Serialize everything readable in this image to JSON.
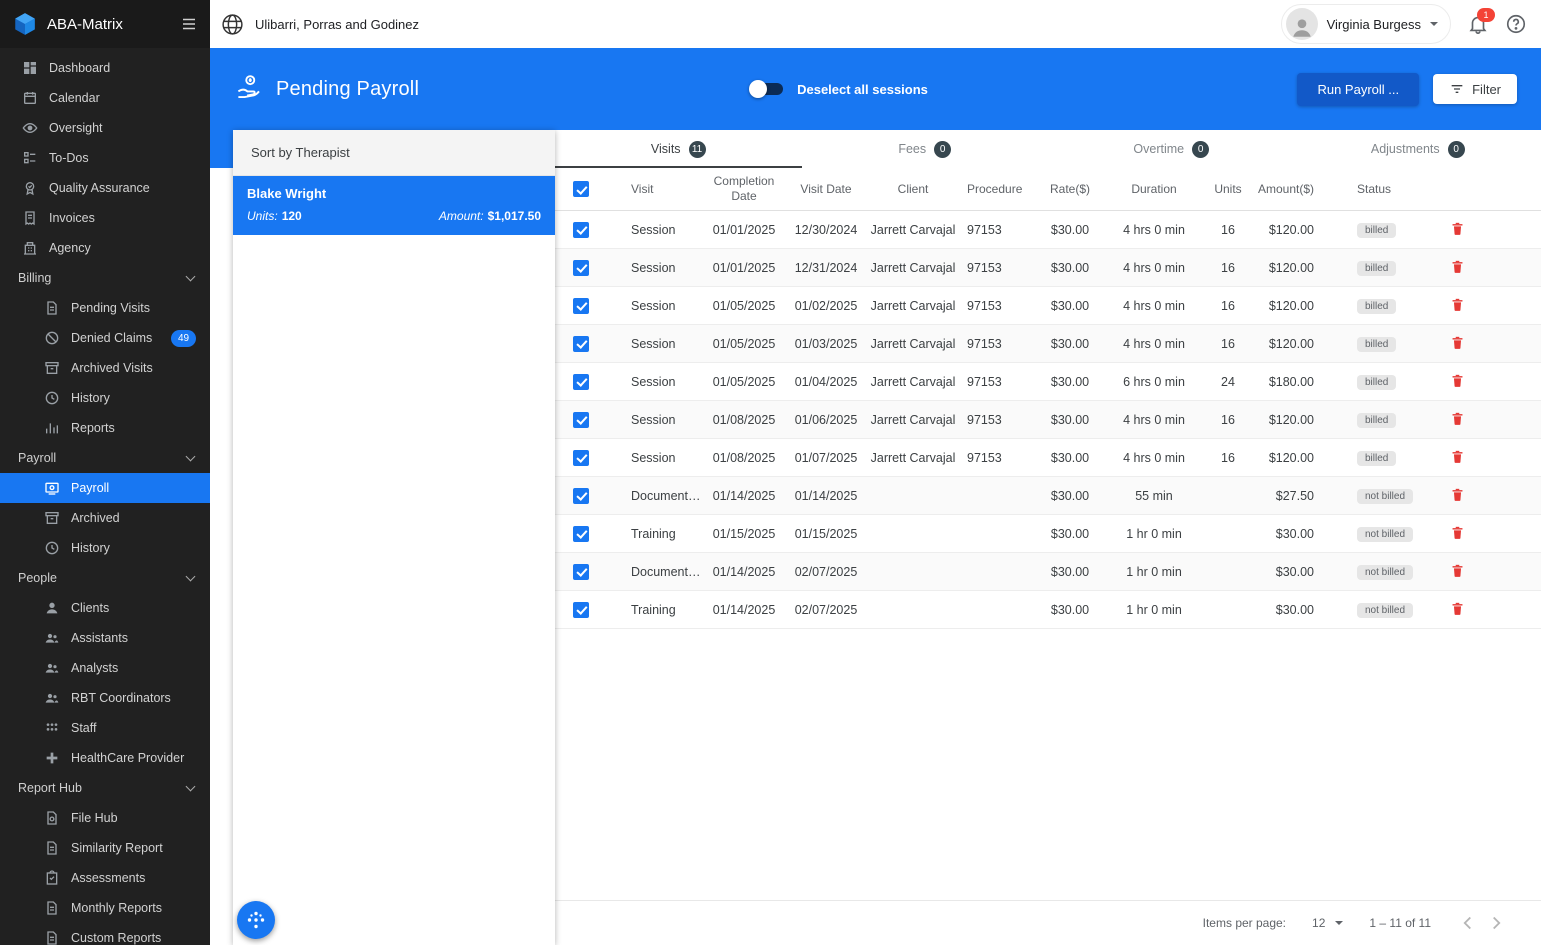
{
  "app": {
    "name": "ABA-Matrix"
  },
  "topbar": {
    "company": "Ulibarri, Porras and Godinez",
    "user": "Virginia Burgess",
    "notification_count": "1"
  },
  "page_header": {
    "title": "Pending Payroll",
    "toggle_label": "Deselect all sessions",
    "run_button": "Run Payroll ...",
    "filter_button": "Filter"
  },
  "sort_panel": {
    "title": "Sort by Therapist",
    "therapist": {
      "name": "Blake Wright",
      "units_label": "Units:",
      "units": "120",
      "amount_label": "Amount:",
      "amount": "$1,017.50"
    }
  },
  "tabs": [
    {
      "label": "Visits",
      "count": "11",
      "active": true
    },
    {
      "label": "Fees",
      "count": "0",
      "active": false
    },
    {
      "label": "Overtime",
      "count": "0",
      "active": false
    },
    {
      "label": "Adjustments",
      "count": "0",
      "active": false
    }
  ],
  "table": {
    "columns": {
      "visit": "Visit",
      "completion_date": "Completion Date",
      "visit_date": "Visit Date",
      "client": "Client",
      "procedure": "Procedure",
      "rate": "Rate($)",
      "duration": "Duration",
      "units": "Units",
      "amount": "Amount($)",
      "status": "Status"
    },
    "rows": [
      {
        "checked": true,
        "visit": "Session",
        "completion_date": "01/01/2025",
        "visit_date": "12/30/2024",
        "client": "Jarrett Carvajal",
        "procedure": "97153",
        "rate": "$30.00",
        "duration": "4 hrs 0 min",
        "units": "16",
        "amount": "$120.00",
        "status": "billed"
      },
      {
        "checked": true,
        "visit": "Session",
        "completion_date": "01/01/2025",
        "visit_date": "12/31/2024",
        "client": "Jarrett Carvajal",
        "procedure": "97153",
        "rate": "$30.00",
        "duration": "4 hrs 0 min",
        "units": "16",
        "amount": "$120.00",
        "status": "billed"
      },
      {
        "checked": true,
        "visit": "Session",
        "completion_date": "01/05/2025",
        "visit_date": "01/02/2025",
        "client": "Jarrett Carvajal",
        "procedure": "97153",
        "rate": "$30.00",
        "duration": "4 hrs 0 min",
        "units": "16",
        "amount": "$120.00",
        "status": "billed"
      },
      {
        "checked": true,
        "visit": "Session",
        "completion_date": "01/05/2025",
        "visit_date": "01/03/2025",
        "client": "Jarrett Carvajal",
        "procedure": "97153",
        "rate": "$30.00",
        "duration": "4 hrs 0 min",
        "units": "16",
        "amount": "$120.00",
        "status": "billed"
      },
      {
        "checked": true,
        "visit": "Session",
        "completion_date": "01/05/2025",
        "visit_date": "01/04/2025",
        "client": "Jarrett Carvajal",
        "procedure": "97153",
        "rate": "$30.00",
        "duration": "6 hrs 0 min",
        "units": "24",
        "amount": "$180.00",
        "status": "billed"
      },
      {
        "checked": true,
        "visit": "Session",
        "completion_date": "01/08/2025",
        "visit_date": "01/06/2025",
        "client": "Jarrett Carvajal",
        "procedure": "97153",
        "rate": "$30.00",
        "duration": "4 hrs 0 min",
        "units": "16",
        "amount": "$120.00",
        "status": "billed"
      },
      {
        "checked": true,
        "visit": "Session",
        "completion_date": "01/08/2025",
        "visit_date": "01/07/2025",
        "client": "Jarrett Carvajal",
        "procedure": "97153",
        "rate": "$30.00",
        "duration": "4 hrs 0 min",
        "units": "16",
        "amount": "$120.00",
        "status": "billed"
      },
      {
        "checked": true,
        "visit": "Documentatio...",
        "completion_date": "01/14/2025",
        "visit_date": "01/14/2025",
        "client": "",
        "procedure": "",
        "rate": "$30.00",
        "duration": "55 min",
        "units": "",
        "amount": "$27.50",
        "status": "not billed"
      },
      {
        "checked": true,
        "visit": "Training",
        "completion_date": "01/15/2025",
        "visit_date": "01/15/2025",
        "client": "",
        "procedure": "",
        "rate": "$30.00",
        "duration": "1 hr 0 min",
        "units": "",
        "amount": "$30.00",
        "status": "not billed"
      },
      {
        "checked": true,
        "visit": "Documentatio...",
        "completion_date": "01/14/2025",
        "visit_date": "02/07/2025",
        "client": "",
        "procedure": "",
        "rate": "$30.00",
        "duration": "1 hr 0 min",
        "units": "",
        "amount": "$30.00",
        "status": "not billed"
      },
      {
        "checked": true,
        "visit": "Training",
        "completion_date": "01/14/2025",
        "visit_date": "02/07/2025",
        "client": "",
        "procedure": "",
        "rate": "$30.00",
        "duration": "1 hr 0 min",
        "units": "",
        "amount": "$30.00",
        "status": "not billed"
      }
    ]
  },
  "pagination": {
    "items_per_page_label": "Items per page:",
    "items_per_page": "12",
    "range": "1 – 11 of 11"
  },
  "sidebar": {
    "items": [
      {
        "label": "Dashboard",
        "icon": "dashboard-icon"
      },
      {
        "label": "Calendar",
        "icon": "calendar-icon"
      },
      {
        "label": "Oversight",
        "icon": "eye-icon"
      },
      {
        "label": "To-Dos",
        "icon": "todo-icon"
      },
      {
        "label": "Quality Assurance",
        "icon": "quality-icon"
      },
      {
        "label": "Invoices",
        "icon": "invoice-icon"
      },
      {
        "label": "Agency",
        "icon": "building-icon"
      }
    ],
    "groups": [
      {
        "label": "Billing",
        "items": [
          {
            "label": "Pending Visits",
            "icon": "document-icon"
          },
          {
            "label": "Denied Claims",
            "icon": "denied-icon",
            "badge": "49"
          },
          {
            "label": "Archived Visits",
            "icon": "archive-icon"
          },
          {
            "label": "History",
            "icon": "history-icon"
          },
          {
            "label": "Reports",
            "icon": "chart-icon"
          }
        ]
      },
      {
        "label": "Payroll",
        "items": [
          {
            "label": "Payroll",
            "icon": "payroll-icon",
            "active": true
          },
          {
            "label": "Archived",
            "icon": "archive-icon"
          },
          {
            "label": "History",
            "icon": "history-icon"
          }
        ]
      },
      {
        "label": "People",
        "items": [
          {
            "label": "Clients",
            "icon": "person-icon"
          },
          {
            "label": "Assistants",
            "icon": "people-icon"
          },
          {
            "label": "Analysts",
            "icon": "people-icon"
          },
          {
            "label": "RBT Coordinators",
            "icon": "people-icon"
          },
          {
            "label": "Staff",
            "icon": "staff-icon"
          },
          {
            "label": "HealthCare Provider",
            "icon": "medical-icon"
          }
        ]
      },
      {
        "label": "Report Hub",
        "items": [
          {
            "label": "File Hub",
            "icon": "file-icon"
          },
          {
            "label": "Similarity Report",
            "icon": "document-icon"
          },
          {
            "label": "Assessments",
            "icon": "clipboard-icon"
          },
          {
            "label": "Monthly Reports",
            "icon": "document-icon"
          },
          {
            "label": "Custom Reports",
            "icon": "document-icon"
          }
        ]
      }
    ]
  },
  "colors": {
    "primary": "#1877f2",
    "primary_dark": "#1259c8",
    "danger": "#e53935"
  }
}
